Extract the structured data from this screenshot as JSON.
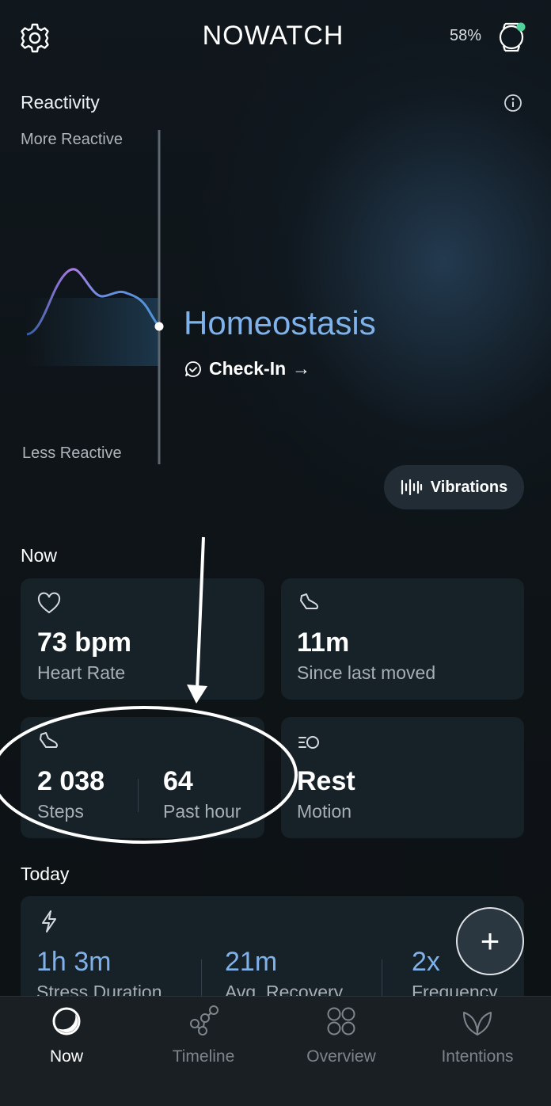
{
  "header": {
    "title": "NOWATCH",
    "battery": "58%",
    "settings_icon": "gear-icon",
    "watch_icon": "watch-icon",
    "watch_status_color": "#4fd39a"
  },
  "reactivity": {
    "title": "Reactivity",
    "top_label": "More Reactive",
    "bottom_label": "Less Reactive",
    "state": "Homeostasis",
    "checkin_label": "Check-In",
    "checkin_arrow": "→",
    "vibrations_label": "Vibrations"
  },
  "now": {
    "title": "Now",
    "heart_rate": {
      "value": "73 bpm",
      "label": "Heart Rate"
    },
    "last_moved": {
      "value": "11m",
      "label": "Since last moved"
    },
    "steps": {
      "value": "2 038",
      "label": "Steps",
      "hour_value": "64",
      "hour_label": "Past hour"
    },
    "motion": {
      "value": "Rest",
      "label": "Motion"
    }
  },
  "today": {
    "title": "Today",
    "stress_duration": {
      "value": "1h 3m",
      "label": "Stress Duration"
    },
    "avg_recovery": {
      "value": "21m",
      "label": "Avg. Recovery"
    },
    "frequency": {
      "value": "2x",
      "label": "Frequency"
    }
  },
  "fab": {
    "label": "+"
  },
  "nav": [
    {
      "label": "Now",
      "icon": "now-ring-icon",
      "active": true
    },
    {
      "label": "Timeline",
      "icon": "timeline-icon",
      "active": false
    },
    {
      "label": "Overview",
      "icon": "overview-grid-icon",
      "active": false
    },
    {
      "label": "Intentions",
      "icon": "leaf-icon",
      "active": false
    }
  ],
  "colors": {
    "accent_blue": "#7fb2ea",
    "curve_purple": "#b07be6",
    "card_bg": "#172128",
    "nav_bg": "#1a1f23"
  }
}
